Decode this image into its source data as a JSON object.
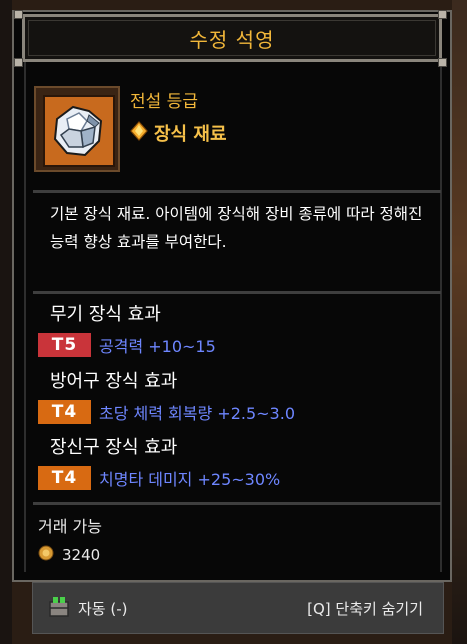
{
  "title": "수정 석영",
  "item": {
    "grade": "전설 등급",
    "type_label": "장식 재료",
    "description": "기본 장식 재료. 아이템에 장식해 장비 종류에 따라 정해진 능력 향상 효과를 부여한다."
  },
  "effects": [
    {
      "title": "무기 장식 효과",
      "tier": "T5",
      "tier_color": "#c9343a",
      "text": "공격력 +10~15"
    },
    {
      "title": "방어구 장식 효과",
      "tier": "T4",
      "tier_color": "#d86a12",
      "text": "초당 체력 회복량 +2.5~3.0"
    },
    {
      "title": "장신구 장식 효과",
      "tier": "T4",
      "tier_color": "#d86a12",
      "text": "치명타 데미지 +25~30%"
    }
  ],
  "trade": {
    "label": "거래 가능",
    "price": "3240"
  },
  "bottom": {
    "auto_label": "자동 (-)",
    "hide_label": "[Q] 단축키 숨기기"
  },
  "colors": {
    "accent": "#f2b73a",
    "effect_text": "#6e86ff"
  }
}
